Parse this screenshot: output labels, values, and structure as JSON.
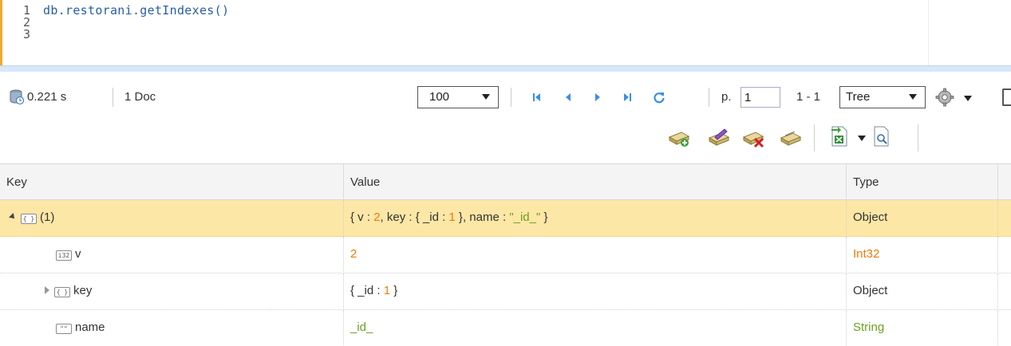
{
  "editor": {
    "line_numbers": [
      "1",
      "2",
      "3"
    ],
    "code": "db.restorani.getIndexes()"
  },
  "toolbar": {
    "time": "0.221 s",
    "doc_count": "1 Doc",
    "page_size": "100",
    "page_label": "p.",
    "page_value": "1",
    "range": "1 - 1",
    "view_mode": "Tree"
  },
  "grid": {
    "columns": [
      "Key",
      "Value",
      "Type"
    ],
    "rows": [
      {
        "key": "(1)",
        "key_icon": "object-icon",
        "value_parts": [
          "{ v : ",
          "2",
          ", key : { _id : ",
          "1",
          " }, name : ",
          "\"_id_\"",
          " }"
        ],
        "type": "Object"
      },
      {
        "key": "v",
        "key_icon": "int32-icon",
        "key_icon_text": "i32",
        "value": "2",
        "type": "Int32"
      },
      {
        "key": "key",
        "key_icon": "object-icon",
        "value_parts": [
          "{ _id : ",
          "1",
          " }"
        ],
        "type": "Object"
      },
      {
        "key": "name",
        "key_icon": "string-icon",
        "key_icon_text": "\"\"",
        "value": "_id_",
        "type": "String"
      }
    ]
  },
  "colors": {
    "accent": "#f0a830",
    "selected_row": "#fde7a6",
    "number": "#f07a0a",
    "string": "#6aa01e",
    "nav_blue": "#3a8ee6"
  }
}
